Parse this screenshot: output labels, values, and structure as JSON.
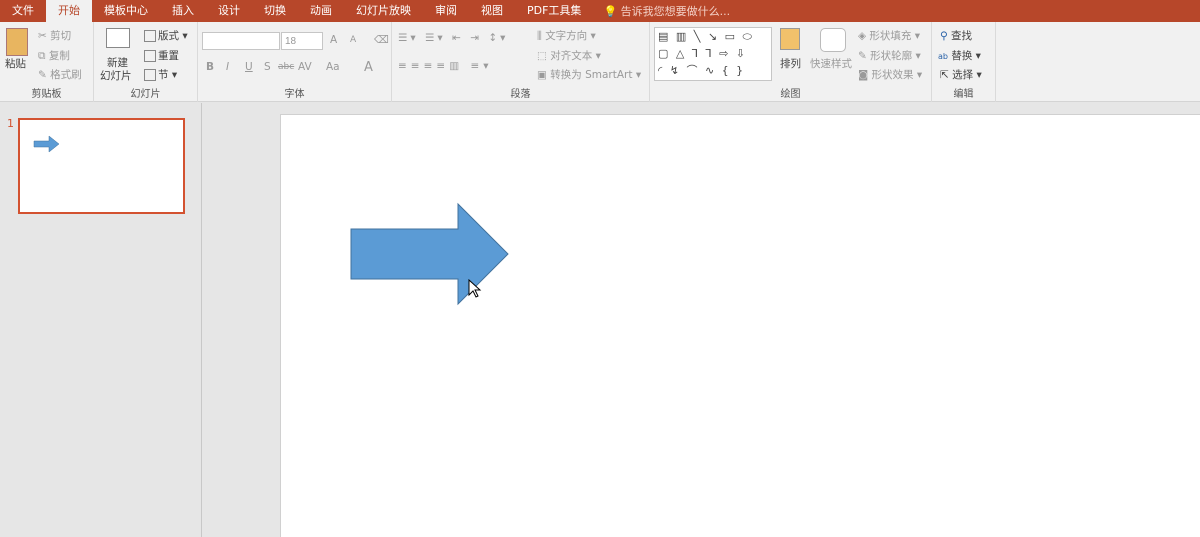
{
  "tabs": [
    "文件",
    "开始",
    "模板中心",
    "插入",
    "设计",
    "切换",
    "动画",
    "幻灯片放映",
    "审阅",
    "视图",
    "PDF工具集"
  ],
  "tell_me": "告诉我您想要做什么...",
  "clipboard": {
    "paste": "粘贴",
    "cut": "剪切",
    "copy": "复制",
    "format_painter": "格式刷",
    "label": "剪贴板"
  },
  "slides": {
    "new_slide": "新建",
    "new_slide2": "幻灯片",
    "layout": "版式",
    "reset": "重置",
    "section": "节",
    "label": "幻灯片"
  },
  "font": {
    "name": "",
    "size": "18",
    "bold": "B",
    "italic": "I",
    "underline": "U",
    "strike": "S",
    "abc": "abc",
    "spacing": "AV",
    "case": "Aa",
    "color": "A",
    "grow": "A",
    "shrink": "A",
    "label": "字体"
  },
  "paragraph": {
    "text_direction": "文字方向",
    "align_text": "对齐文本",
    "smartart": "转换为 SmartArt",
    "label": "段落"
  },
  "drawing": {
    "shapes_row1": "▤ ▥ ╲ ↘ ▭ ⬭",
    "shapes_row2": "▢ △ ⅂ ⅂ ⇨ ⇩",
    "shapes_row3": "◜ ↯ ⌒ ∿ { }",
    "arrange": "排列",
    "quick_styles": "快速样式",
    "fill": "形状填充",
    "outline": "形状轮廓",
    "effects": "形状效果",
    "label": "绘图"
  },
  "editing": {
    "find": "查找",
    "replace": "替换",
    "select": "选择",
    "label": "编辑"
  },
  "slide_panel": {
    "number": "1"
  },
  "colors": {
    "accent": "#b7472a",
    "shape_fill": "#5b9bd5",
    "shape_stroke": "#41719c"
  }
}
